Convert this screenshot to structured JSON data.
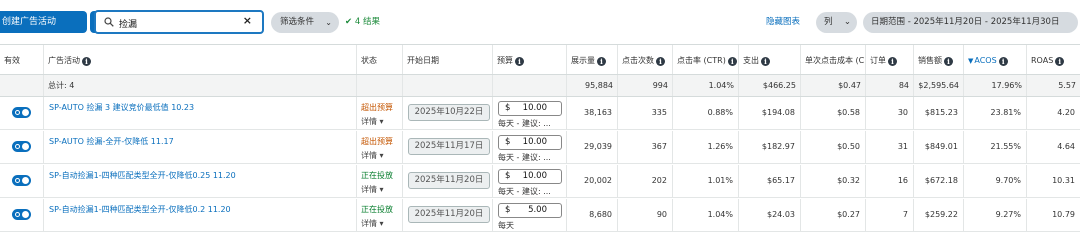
{
  "toolbar": {
    "create_label": "创建广告活动",
    "more_label": "···",
    "search_value": "捡漏",
    "filter_label": "筛选条件",
    "result_label": "4 结果",
    "hide_chart_label": "隐藏图表",
    "columns_label": "列",
    "date_range_label": "日期范围 - 2025年11月20日 - 2025年11月30日"
  },
  "headers": {
    "active": "有效",
    "campaign": "广告活动",
    "status": "状态",
    "start_date": "开始日期",
    "budget": "预算",
    "impressions": "展示量",
    "clicks": "点击次数",
    "ctr": "点击率 (CTR)",
    "spend": "支出",
    "cpc": "单次点击成本 (CPC)",
    "orders": "订单",
    "sales": "销售额",
    "acos": "ACOS",
    "roas": "ROAS"
  },
  "totals": {
    "label": "总计: 4",
    "impressions": "95,884",
    "clicks": "994",
    "ctr": "1.04%",
    "spend": "$466.25",
    "cpc": "$0.47",
    "orders": "84",
    "sales": "$2,595.64",
    "acos": "17.96%",
    "roas": "5.57"
  },
  "rows": [
    {
      "name": "SP-AUTO 捡漏 3 建议竞价最低值 10.23",
      "status": "超出预算",
      "status_color": "#c45500",
      "status_detail": "详情",
      "start_date": "2025年10月22日",
      "budget_currency": "$",
      "budget_amount": "10.00",
      "budget_sub": "每天 - 建议: ...",
      "impressions": "38,163",
      "clicks": "335",
      "ctr": "0.88%",
      "spend": "$194.08",
      "cpc": "$0.58",
      "orders": "30",
      "sales": "$815.23",
      "acos": "23.81%",
      "roas": "4.20"
    },
    {
      "name": "SP-AUTO 捡漏-全开-仅降低 11.17",
      "status": "超出预算",
      "status_color": "#c45500",
      "status_detail": "详情",
      "start_date": "2025年11月17日",
      "budget_currency": "$",
      "budget_amount": "10.00",
      "budget_sub": "每天 - 建议: ...",
      "impressions": "29,039",
      "clicks": "367",
      "ctr": "1.26%",
      "spend": "$182.97",
      "cpc": "$0.50",
      "orders": "31",
      "sales": "$849.01",
      "acos": "21.55%",
      "roas": "4.64"
    },
    {
      "name": "SP-自动捡漏1-四种匹配类型全开-仅降低0.25 11.20",
      "status": "正在投放",
      "status_color": "#067d2c",
      "status_detail": "详情",
      "start_date": "2025年11月20日",
      "budget_currency": "$",
      "budget_amount": "10.00",
      "budget_sub": "每天 - 建议: ...",
      "impressions": "20,002",
      "clicks": "202",
      "ctr": "1.01%",
      "spend": "$65.17",
      "cpc": "$0.32",
      "orders": "16",
      "sales": "$672.18",
      "acos": "9.70%",
      "roas": "10.31"
    },
    {
      "name": "SP-自动捡漏1-四种匹配类型全开-仅降低0.2 11.20",
      "status": "正在投放",
      "status_color": "#067d2c",
      "status_detail": "详情",
      "start_date": "2025年11月20日",
      "budget_currency": "$",
      "budget_amount": "5.00",
      "budget_sub": "每天",
      "impressions": "8,680",
      "clicks": "90",
      "ctr": "1.04%",
      "spend": "$24.03",
      "cpc": "$0.27",
      "orders": "7",
      "sales": "$259.22",
      "acos": "9.27%",
      "roas": "10.79"
    }
  ],
  "colors": {
    "primary": "#0a6fbd",
    "over_budget": "#c45500",
    "delivering": "#067d2c",
    "result_ok": "#1b8a3a"
  }
}
